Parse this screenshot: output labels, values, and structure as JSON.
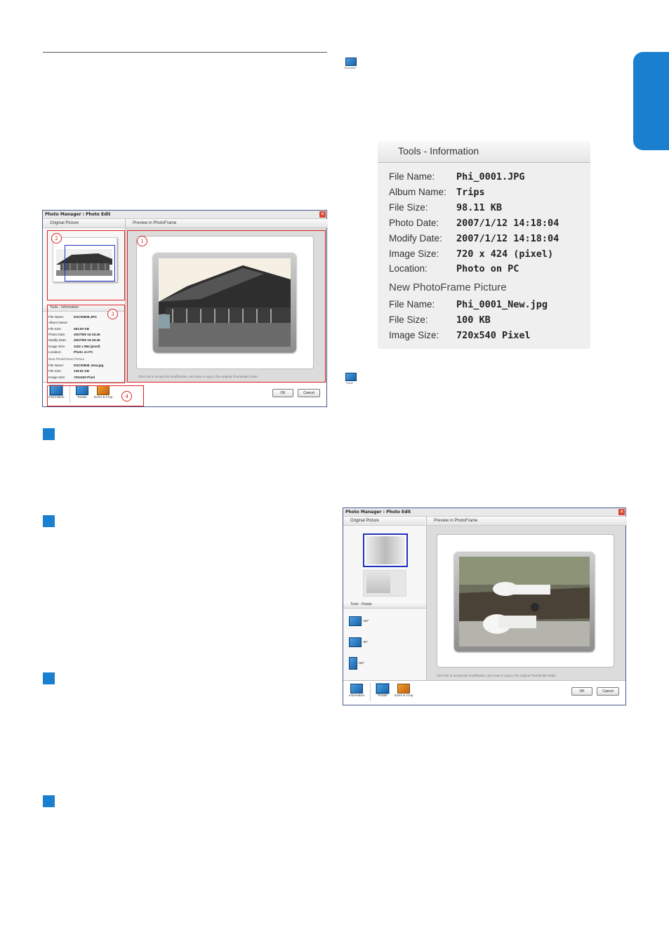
{
  "side_tab_color": "#1b7fd0",
  "window1": {
    "title": "Photo Manager : Photo Edit",
    "original_header": "Original Picture",
    "preview_header": "Preview in PhotoFrame",
    "tools_header": "Tools - Information",
    "info_rows": [
      {
        "k": "File Name:",
        "v": "DSC00908.JPG"
      },
      {
        "k": "Album Name:",
        "v": ""
      },
      {
        "k": "File Size:",
        "v": "493.60 KB"
      },
      {
        "k": "Photo Date:",
        "v": "2007/6/9 15:18:46"
      },
      {
        "k": "Modify Date:",
        "v": "2007/6/9 15:18:46"
      },
      {
        "k": "Image Size:",
        "v": "1152 x 864 (pixel)"
      },
      {
        "k": "Location:",
        "v": "Photo on PC"
      }
    ],
    "new_title": "New PhotoFrame Picture",
    "new_rows": [
      {
        "k": "File Name:",
        "v": "DSC00908_New.jpg"
      },
      {
        "k": "File Size:",
        "v": "139.81 KB"
      },
      {
        "k": "Image Size:",
        "v": "720x540 Pixel"
      }
    ],
    "hint": "Click OK to accept the modification, and save a copy in the original Thumbnails folder.",
    "tools": [
      "Information",
      "Rotate",
      "Zoom & Crop"
    ],
    "ok": "OK",
    "cancel": "Cancel",
    "callouts": [
      "1",
      "2",
      "3",
      "4"
    ]
  },
  "small_icons": {
    "information_label": "Information",
    "rotate_label": "Rotate"
  },
  "info_panel": {
    "header": "Tools - Information",
    "rows": [
      {
        "k": "File Name:",
        "v": "Phi_0001.JPG"
      },
      {
        "k": "Album Name:",
        "v": "Trips"
      },
      {
        "k": "File Size:",
        "v": "98.11 KB"
      },
      {
        "k": "Photo Date:",
        "v": "2007/1/12 14:18:04"
      },
      {
        "k": "Modify Date:",
        "v": "2007/1/12 14:18:04"
      },
      {
        "k": "Image Size:",
        "v": "720 x 424 (pixel)"
      },
      {
        "k": "Location:",
        "v": "Photo on PC"
      }
    ],
    "new_title": "New PhotoFrame Picture",
    "new_rows": [
      {
        "k": "File Name:",
        "v": "Phi_0001_New.jpg"
      },
      {
        "k": "File Size:",
        "v": "100 KB"
      },
      {
        "k": "Image Size:",
        "v": "720x540 Pixel"
      }
    ]
  },
  "window2": {
    "title": "Photo Manager : Photo Edit",
    "original_header": "Original Picture",
    "preview_header": "Preview in PhotoFrame",
    "tools_header": "Tools - Rotate",
    "rotate_options": [
      "+90°",
      "-90°",
      "180°"
    ],
    "hint": "Click OK to accept the modification, and save a copy in the original Thumbnails folder.",
    "tools": [
      "Information",
      "Rotate",
      "Zoom & Crop"
    ],
    "ok": "OK",
    "cancel": "Cancel"
  }
}
